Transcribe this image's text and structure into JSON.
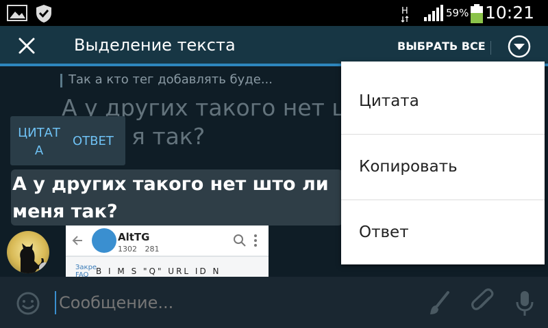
{
  "status_bar": {
    "battery_percent": "59%",
    "time": "10:21",
    "network_indicator": "H",
    "icons": [
      "gallery-icon",
      "shield-check-icon",
      "network-h-icon",
      "signal-icon",
      "battery-icon"
    ]
  },
  "action_bar": {
    "title": "Выделение текста",
    "select_all_label": "ВЫБРАТЬ ВСЕ",
    "icons": [
      "close-icon",
      "overflow-dropdown-icon"
    ]
  },
  "chat": {
    "reply_preview": "Так а кто тег добавлять буде...",
    "bg_message_line1": "А у других такого нет шт",
    "bg_message_line2": "я так?",
    "popup": {
      "quote_label_line1": "ЦИТАТ",
      "quote_label_line2": "А",
      "reply_label": "ОТВЕТ"
    },
    "selected_message_line1": "А у других такого нет што ли",
    "selected_message_line2": "меня так?",
    "image_preview": {
      "title": "AltTG",
      "members": "1302",
      "views": "281",
      "toolbar": "B  I  M  S  \"Q\" URL  ID  N",
      "side_text_1": "Закре",
      "side_text_2": "FAQ"
    }
  },
  "input_bar": {
    "placeholder": "Сообщение...",
    "icons": [
      "emoji-icon",
      "brush-icon",
      "attach-icon",
      "mic-icon"
    ]
  },
  "menu": {
    "items": [
      {
        "label": "Цитата"
      },
      {
        "label": "Копировать"
      },
      {
        "label": "Ответ"
      }
    ]
  },
  "colors": {
    "action_bar": "#173644",
    "accent": "#2e86bd",
    "popup_text": "#6fc2f5",
    "background": "#0f1d26"
  }
}
